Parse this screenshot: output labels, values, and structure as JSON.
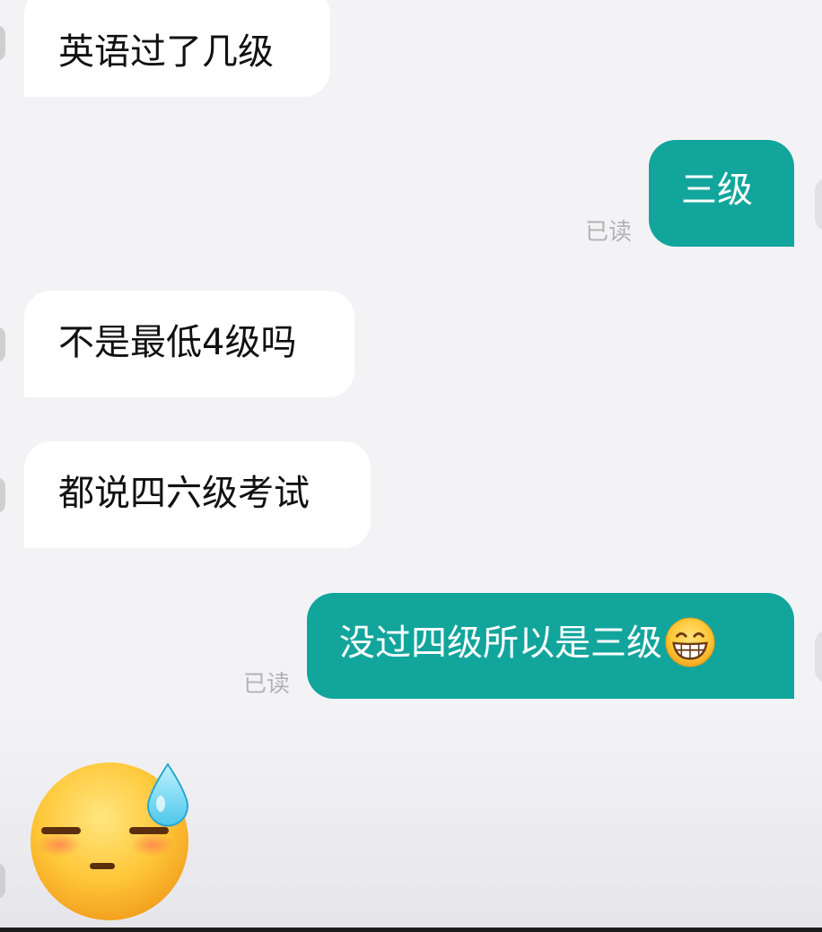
{
  "conversation": {
    "messages": [
      {
        "side": "left",
        "text": "英语过了几级"
      },
      {
        "side": "right",
        "text": "三级",
        "status": "已读"
      },
      {
        "side": "left",
        "text": "不是最低4级吗"
      },
      {
        "side": "left",
        "text": "都说四六级考试"
      },
      {
        "side": "right",
        "text": "没过四级所以是三级",
        "status": "已读",
        "emoji": "grinning-face-icon"
      },
      {
        "side": "left",
        "sticker": "downcast-face-with-sweat-icon"
      }
    ]
  },
  "colors": {
    "background": "#f3f3f6",
    "incoming_bubble": "#ffffff",
    "outgoing_bubble": "#12a59c",
    "read_status": "#b3b3b3"
  }
}
